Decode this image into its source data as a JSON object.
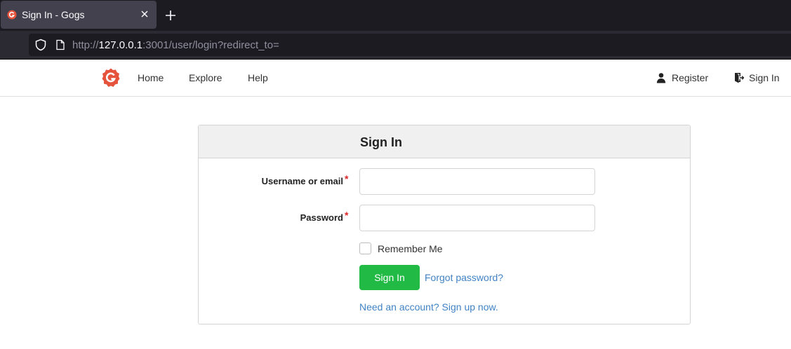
{
  "browser": {
    "tab_title": "Sign In - Gogs",
    "url_prefix": "http://",
    "url_host": "127.0.0.1",
    "url_rest": ":3001/user/login?redirect_to="
  },
  "header": {
    "nav": [
      {
        "label": "Home"
      },
      {
        "label": "Explore"
      },
      {
        "label": "Help"
      }
    ],
    "register_label": "Register",
    "signin_label": "Sign In"
  },
  "login": {
    "title": "Sign In",
    "username_label": "Username or email",
    "username_value": "",
    "password_label": "Password",
    "password_value": "",
    "required_mark": "*",
    "remember_label": "Remember Me",
    "remember_checked": false,
    "submit_label": "Sign In",
    "forgot_label": "Forgot password?",
    "signup_label": "Need an account? Sign up now."
  },
  "colors": {
    "accent_green": "#21ba45",
    "link_blue": "#4183c4",
    "required_red": "#db2828",
    "logo_red": "#e5533d"
  }
}
